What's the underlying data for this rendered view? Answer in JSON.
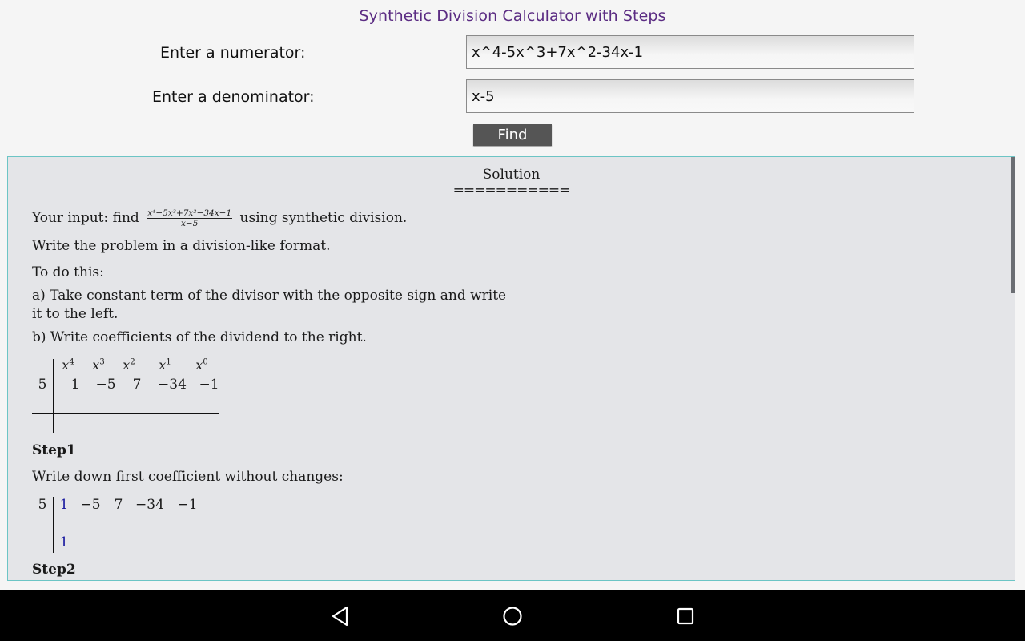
{
  "app": {
    "title": "Synthetic Division Calculator with Steps"
  },
  "form": {
    "numerator_label": "Enter a numerator:",
    "numerator_value": "x^4-5x^3+7x^2-34x-1",
    "denominator_label": "Enter a denominator:",
    "denominator_value": "x-5",
    "find_label": "Find"
  },
  "solution": {
    "title": "Solution",
    "rule": "===========",
    "input_prefix": "Your input: find",
    "input_numerator": "x⁴−5x³+7x²−34x−1",
    "input_denominator": "x−5",
    "input_suffix": "using synthetic division.",
    "write_format": "Write the problem in a division-like format.",
    "todo": "To do this:",
    "step_a_line1": "a) Take constant term of the divisor with the opposite sign and write",
    "step_a_line2": "it to the left.",
    "step_b": "b) Write coefficients of the dividend to the right.",
    "table1": {
      "divisor": "5",
      "powers": [
        {
          "base": "x",
          "exp": "4"
        },
        {
          "base": "x",
          "exp": "3"
        },
        {
          "base": "x",
          "exp": "2"
        },
        {
          "base": "x",
          "exp": "1"
        },
        {
          "base": "x",
          "exp": "0"
        }
      ],
      "coefficients": [
        "1",
        "−5",
        "7",
        "−34",
        "−1"
      ]
    },
    "step1": {
      "heading": "Step1",
      "text": "Write down first coefficient without changes:",
      "divisor": "5",
      "coefficients": [
        "1",
        "−5",
        "7",
        "−34",
        "−1"
      ],
      "result": [
        "1"
      ]
    },
    "step2": {
      "heading": "Step2"
    }
  },
  "colors": {
    "title": "#5b2c83",
    "highlight": "#1a1aa0",
    "panel_border": "#6cc5c5",
    "panel_bg": "#e4e5e8",
    "button_bg": "#555555"
  },
  "navbar": {
    "icons": [
      "back-icon",
      "home-icon",
      "recents-icon"
    ]
  }
}
